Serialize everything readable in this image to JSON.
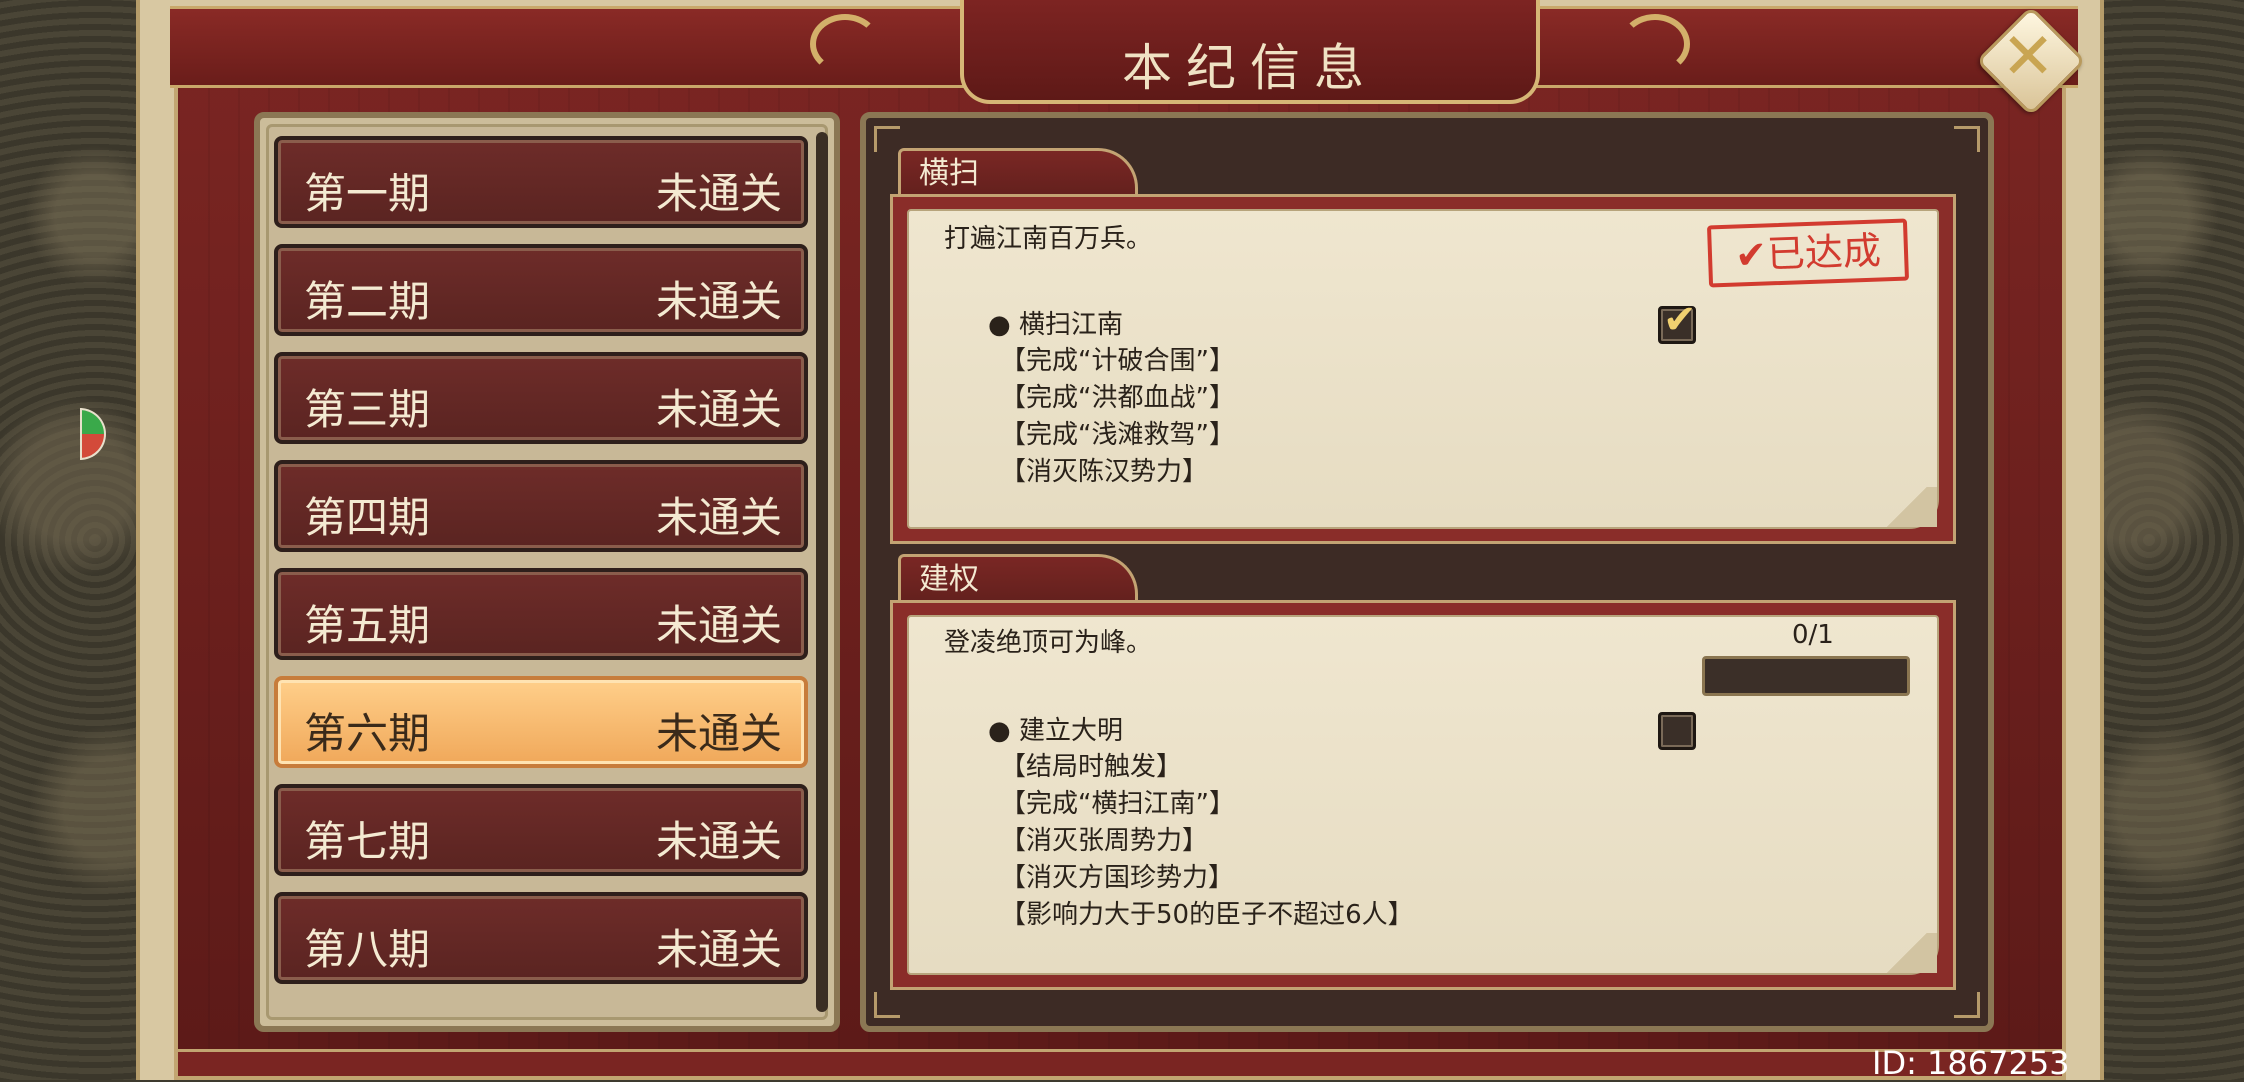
{
  "title": "本纪信息",
  "close_icon": "close-x-icon",
  "periods": [
    {
      "name": "第一期",
      "status": "未通关"
    },
    {
      "name": "第二期",
      "status": "未通关"
    },
    {
      "name": "第三期",
      "status": "未通关"
    },
    {
      "name": "第四期",
      "status": "未通关"
    },
    {
      "name": "第五期",
      "status": "未通关"
    },
    {
      "name": "第六期",
      "status": "未通关",
      "selected": true
    },
    {
      "name": "第七期",
      "status": "未通关"
    },
    {
      "name": "第八期",
      "status": "未通关"
    }
  ],
  "sections": [
    {
      "tab": "横扫",
      "description": "打遍江南百万兵。",
      "stamp": "✔已达成",
      "goal": "● 横扫江南",
      "checked": true,
      "requirements": [
        "【完成“计破合围”】",
        "【完成“洪都血战”】",
        "【完成“浅滩救驾”】",
        "【消灭陈汉势力】"
      ]
    },
    {
      "tab": "建权",
      "description": "登凌绝顶可为峰。",
      "progress_text": "0/1",
      "progress": 0,
      "goal": "● 建立大明",
      "checked": false,
      "requirements": [
        "【结局时触发】",
        "【完成“横扫江南”】",
        "【消灭张周势力】",
        "【消灭方国珍势力】",
        "【影响力大于50的臣子不超过6人】"
      ]
    }
  ],
  "id_label": "ID: 1867253",
  "colors": {
    "accent_red": "#7a2522",
    "gold": "#c9a86a",
    "selected": "#f0a85a",
    "stamp_red": "#d23b2f"
  }
}
